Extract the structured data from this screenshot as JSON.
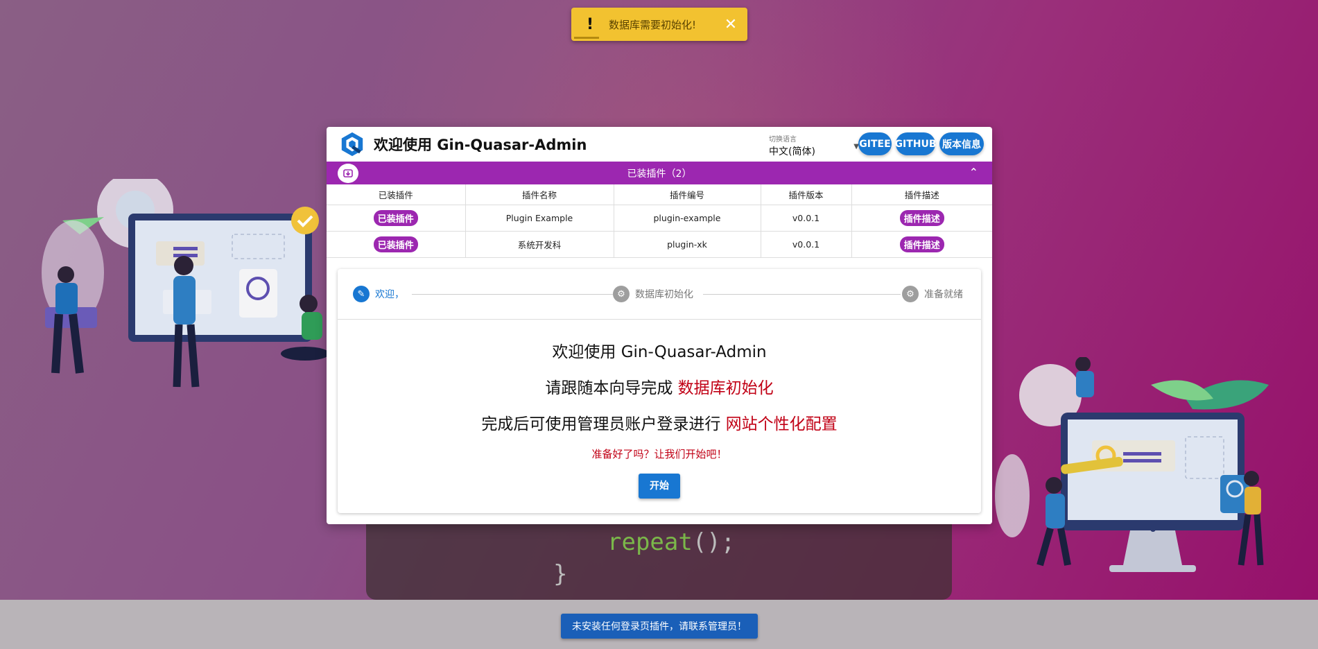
{
  "toast": {
    "message": "数据库需要初始化!",
    "icon": "exclamation-icon",
    "close_icon": "close-icon"
  },
  "code": {
    "line1": "repeat",
    "line1_punct": "();",
    "line2": "}"
  },
  "footer": {
    "button_label": "未安装任何登录页插件，请联系管理员！"
  },
  "header": {
    "title": "欢迎使用 Gin-Quasar-Admin",
    "lang_label": "切换语言",
    "lang_value": "中文(简体)",
    "buttons": [
      "GITEE",
      "GITHUB",
      "版本信息"
    ]
  },
  "plugins": {
    "bar_title": "已装插件（2）",
    "columns": [
      "已装插件",
      "插件名称",
      "插件编号",
      "插件版本",
      "插件描述"
    ],
    "rows": [
      {
        "badge": "已装插件",
        "name": "Plugin Example",
        "code": "plugin-example",
        "version": "v0.0.1",
        "desc": "插件描述"
      },
      {
        "badge": "已装插件",
        "name": "系统开发科",
        "code": "plugin-xk",
        "version": "v0.0.1",
        "desc": "插件描述"
      }
    ]
  },
  "stepper": {
    "steps": [
      "欢迎，",
      "数据库初始化",
      "准备就绪"
    ],
    "line1": "欢迎使用 Gin-Quasar-Admin",
    "line2_prefix": "请跟随本向导完成 ",
    "line2_highlight": "数据库初始化",
    "line3_prefix": "完成后可使用管理员账户登录进行 ",
    "line3_highlight": "网站个性化配置",
    "line4": "准备好了吗？让我们开始吧！",
    "start_label": "开始"
  },
  "colors": {
    "primary": "#1877d2",
    "accent": "#9c27b0",
    "negative": "#c10015",
    "warning": "#f2c230"
  }
}
